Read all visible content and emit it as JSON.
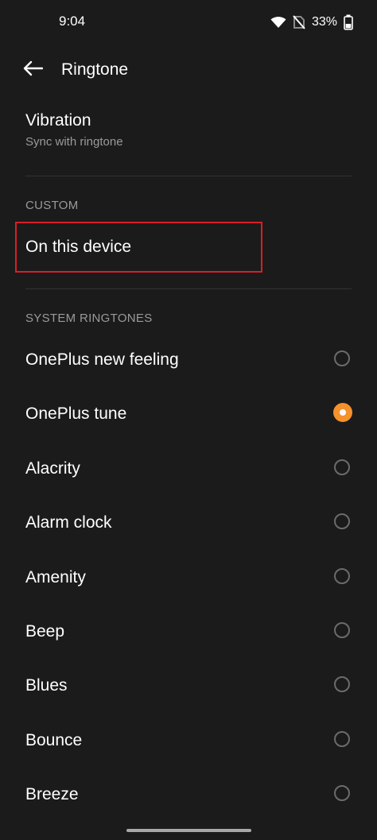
{
  "status_bar": {
    "time": "9:04",
    "battery_percent": "33%",
    "icons": [
      "wifi-icon",
      "no-sim-icon",
      "battery-icon"
    ]
  },
  "header": {
    "back_icon": "arrow-left-icon",
    "title": "Ringtone"
  },
  "vibration": {
    "title": "Vibration",
    "subtitle": "Sync with ringtone"
  },
  "custom": {
    "section_title": "CUSTOM",
    "item_label": "On this device"
  },
  "system": {
    "section_title": "SYSTEM RINGTONES",
    "items": [
      {
        "label": "OnePlus new feeling",
        "selected": false
      },
      {
        "label": "OnePlus tune",
        "selected": true
      },
      {
        "label": "Alacrity",
        "selected": false
      },
      {
        "label": "Alarm clock",
        "selected": false
      },
      {
        "label": "Amenity",
        "selected": false
      },
      {
        "label": "Beep",
        "selected": false
      },
      {
        "label": "Blues",
        "selected": false
      },
      {
        "label": "Bounce",
        "selected": false
      },
      {
        "label": "Breeze",
        "selected": false
      }
    ]
  },
  "colors": {
    "background": "#1b1b1b",
    "accent": "#f5922c",
    "highlight_border": "#d81f26"
  }
}
